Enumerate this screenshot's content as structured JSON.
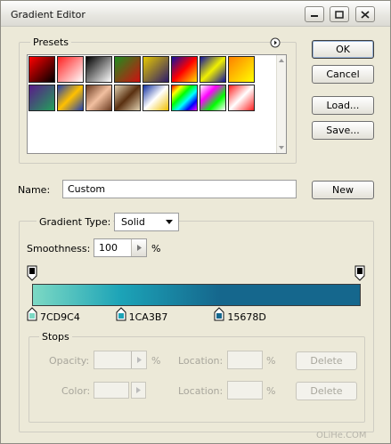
{
  "window": {
    "title": "Gradient Editor"
  },
  "presets": {
    "label": "Presets",
    "swatches": [
      [
        "#ff0000",
        "#000000"
      ],
      [
        "#ff2020",
        "#ffffff"
      ],
      [
        "#000000",
        "#ffffff"
      ],
      [
        "#1e8e1e",
        "#d01010"
      ],
      [
        "#e6c800",
        "#2c1c6c"
      ],
      [
        "#1010a0",
        "#ff0000",
        "#ffe000"
      ],
      [
        "#1010a0",
        "#f0f000",
        "#1010a0"
      ],
      [
        "#ff8000",
        "#ffff00"
      ],
      [
        "#5a1a8a",
        "#22a05a"
      ],
      [
        "#2040b0",
        "#ffc000",
        "#2040b0"
      ],
      [
        "#6a3a20",
        "#f2c0a0",
        "#6a3a20"
      ],
      [
        "#e0d0b0",
        "#5a3010",
        "#e0d0b0"
      ],
      [
        "#1030a0",
        "#ffffff",
        "#f0c000"
      ],
      [
        "#ff0000",
        "#ffff00",
        "#00ff00",
        "#00ffff",
        "#0000ff",
        "#ff00ff"
      ],
      [
        "#ffffff",
        "#ff00ff",
        "#00ff00",
        "#ffffff"
      ],
      [
        "#ff2020",
        "#ffffff",
        "#ff2020"
      ]
    ]
  },
  "buttons": {
    "ok": "OK",
    "cancel": "Cancel",
    "load": "Load...",
    "save": "Save...",
    "new": "New",
    "delete_opacity": "Delete",
    "delete_color": "Delete"
  },
  "name_field": {
    "label": "Name:",
    "value": "Custom"
  },
  "gradient_type": {
    "label": "Gradient Type:",
    "value": "Solid",
    "smoothness_label": "Smoothness:",
    "smoothness_value": "100",
    "smoothness_unit": "%"
  },
  "color_stops": [
    {
      "hex": "7CD9C4",
      "color": "#7cd9c4",
      "location": 0
    },
    {
      "hex": "1CA3B7",
      "color": "#1ca3b7",
      "location": 27
    },
    {
      "hex": "15678D",
      "color": "#15678d",
      "location": 57
    }
  ],
  "stops": {
    "label": "Stops",
    "opacity_label": "Opacity:",
    "opacity_unit": "%",
    "location_label": "Location:",
    "location_unit": "%",
    "color_label": "Color:",
    "location2_label": "Location:",
    "location2_unit": "%"
  },
  "watermark": "OLiHe.COM"
}
